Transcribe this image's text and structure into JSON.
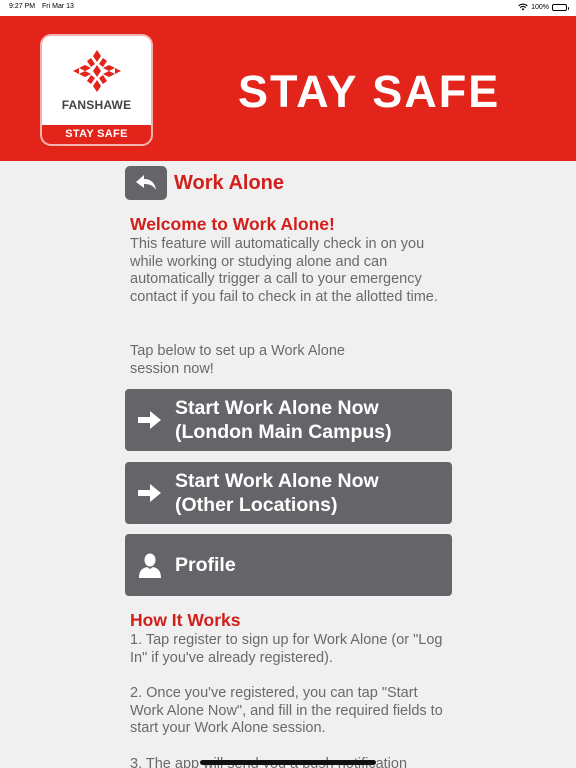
{
  "status_bar": {
    "time": "9:27 PM",
    "date": "Fri Mar 13",
    "battery": "100%"
  },
  "header": {
    "logo_name": "FANSHAWE",
    "logo_band": "STAY SAFE",
    "title": "STAY SAFE",
    "color": "#e3241b"
  },
  "nav": {
    "title": "Work Alone",
    "back_icon": "back-arrow-icon"
  },
  "welcome": {
    "heading": "Welcome to Work Alone!",
    "text": "This feature will automatically check in on you while working or studying alone and can automatically trigger a call to your emergency contact if you fail to check in at the allotted time.",
    "prompt": "Tap below to set up a Work Alone\nsession now!"
  },
  "buttons": [
    {
      "label": "Start Work Alone Now\n(London Main Campus)",
      "icon": "arrow-right-icon"
    },
    {
      "label": "Start Work Alone Now\n(Other Locations)",
      "icon": "arrow-right-icon"
    },
    {
      "label": "Profile",
      "icon": "person-icon"
    }
  ],
  "how_it_works": {
    "heading": "How It Works",
    "step1": "1. Tap register to sign up for Work Alone (or \"Log In\" if you've already registered).",
    "step2": "2. Once you've registered, you can tap \"Start Work Alone Now\", and fill in the required fields to start your Work Alone session.",
    "step3": "3. The app will send you a push notification"
  },
  "colors": {
    "accent": "#d1201c",
    "button": "#656569",
    "text": "#6a6a6a"
  }
}
